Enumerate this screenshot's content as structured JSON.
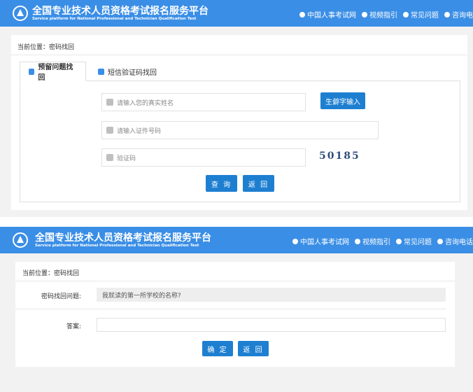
{
  "header": {
    "title": "全国专业技术人员资格考试报名服务平台",
    "subtitle": "Service platform for National Professional and Technician Qualification Test",
    "nav": [
      {
        "label": "中国人事考试网",
        "icon": "home-icon"
      },
      {
        "label": "视频指引",
        "icon": "play-icon"
      },
      {
        "label": "常见问题",
        "icon": "question-icon"
      },
      {
        "label": "咨询电话",
        "icon": "phone-icon"
      }
    ]
  },
  "breadcrumb": "当前位置：密码找回",
  "screen1": {
    "tabs": [
      {
        "label": "预留问题找回",
        "icon": "edit-icon"
      },
      {
        "label": "短信验证码找回",
        "icon": "phone-icon"
      }
    ],
    "name_placeholder": "请输入您的真实姓名",
    "rare_char_button": "生僻字输入",
    "id_placeholder": "请输入证件号码",
    "captcha_placeholder": "验证码",
    "captcha_text": "50185",
    "query_button": "查 询",
    "back_button": "返 回"
  },
  "screen2": {
    "question_label": "密码找回问题:",
    "question_value": "我就读的第一所学校的名称?",
    "answer_label": "答案:",
    "confirm_button": "确 定",
    "back_button": "返 回"
  }
}
